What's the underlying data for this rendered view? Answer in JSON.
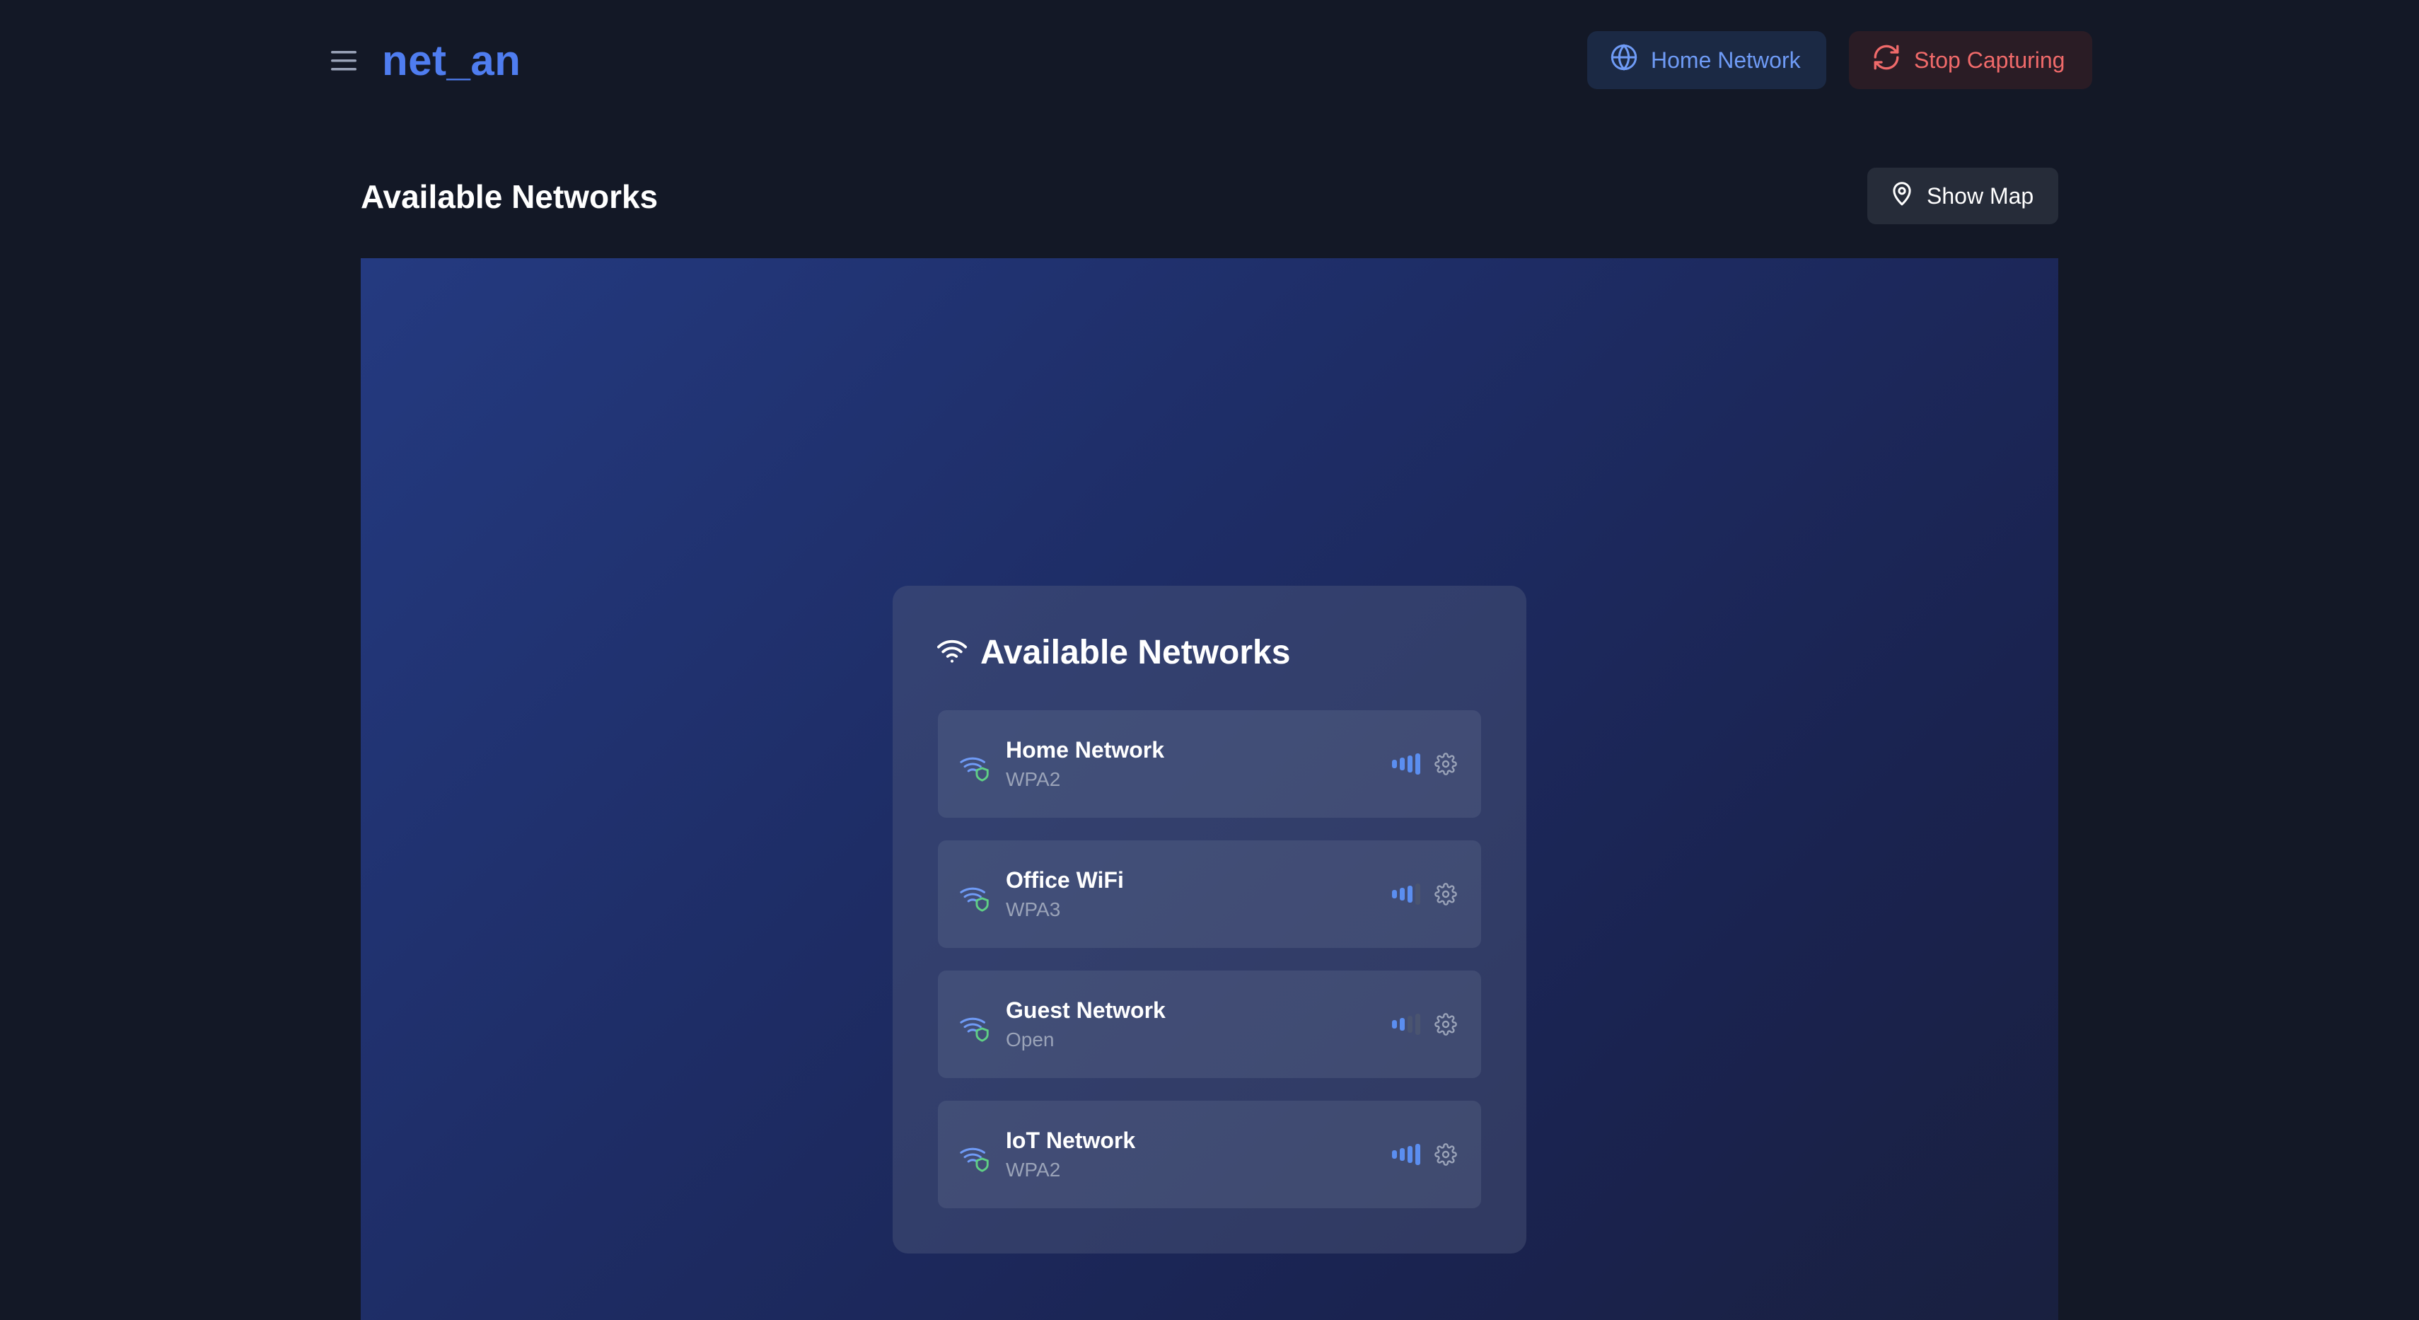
{
  "app": {
    "name": "net_an"
  },
  "header": {
    "current_network_label": "Home Network",
    "capture_button_label": "Stop Capturing"
  },
  "page": {
    "title": "Available Networks",
    "show_map_label": "Show Map"
  },
  "panel": {
    "title": "Available Networks",
    "networks": [
      {
        "name": "Home Network",
        "security": "WPA2",
        "signal_bars": 4
      },
      {
        "name": "Office WiFi",
        "security": "WPA3",
        "signal_bars": 3
      },
      {
        "name": "Guest Network",
        "security": "Open",
        "signal_bars": 2
      },
      {
        "name": "IoT Network",
        "security": "WPA2",
        "signal_bars": 4
      }
    ]
  },
  "colors": {
    "brand": "#4f7df0",
    "accent_blue": "#6f9bf6",
    "danger": "#f06a6a",
    "secure_green": "#5fcf85",
    "signal_active": "#5b8ef0",
    "signal_inactive": "#4a5470",
    "background": "#131826"
  },
  "icons": {
    "menu": "hamburger-menu-icon",
    "network": "globe-icon",
    "capture": "refresh-icon",
    "map": "map-pin-icon",
    "panel": "wifi-icon",
    "row": "wifi-secure-icon",
    "settings": "gear-icon"
  }
}
